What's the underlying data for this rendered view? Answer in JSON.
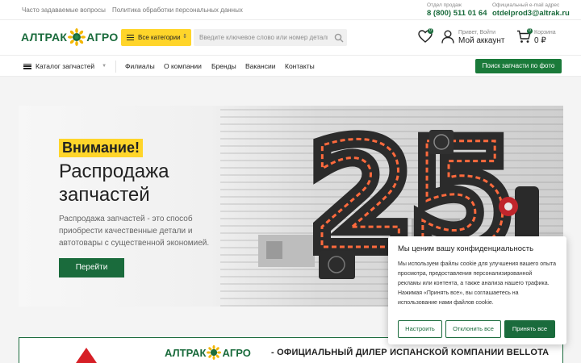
{
  "topbar": {
    "links": [
      "Часто задаваемые вопросы",
      "Политика обработки персональных данных"
    ],
    "sales_caption": "Отдел продаж",
    "sales_phone": "8 (800) 511 01 64",
    "email_caption": "Официальный e-mail адрес",
    "email": "otdelprod3@altrak.ru"
  },
  "header": {
    "logo_left": "АЛТРАК",
    "logo_right": "АГРО",
    "categories_label": "Все категории",
    "search_placeholder": "Введите ключевое слово или номер детали",
    "favorites_count": "0",
    "account_greeting": "Привет, Войти",
    "account_label": "Мой аккаунт",
    "cart_count": "0",
    "cart_caption": "Корзина",
    "cart_total": "0 ₽"
  },
  "nav": {
    "catalog_label": "Каталог запчастей",
    "items": [
      "Филиалы",
      "О компании",
      "Бренды",
      "Вакансии",
      "Контакты"
    ],
    "photo_search_label": "Поиск запчасти по фото"
  },
  "banner": {
    "note": "Внимание!",
    "title": "Распродажа запчастей",
    "description": "Распродажа запчастей - это способ приобрести качественные детали и автотовары с существенной экономией.",
    "button_label": "Перейти",
    "art_number": "25"
  },
  "dealer_strip": {
    "logo_left": "АЛТРАК",
    "logo_right": "АГРО",
    "text": "- ОФИЦИАЛЬНЫЙ ДИЛЕР ИСПАНСКОЙ КОМПАНИИ BELLOTA"
  },
  "cookie": {
    "title": "Мы ценим вашу конфиденциальность",
    "text": "Мы используем файлы cookie для улучшения вашего опыта просмотра, предоставления персонализированной рекламы или контента, а также анализа нашего трафика. Нажимая «Принять все», вы соглашаетесь на использование нами файлов cookie.",
    "customize_label": "Настроить",
    "reject_label": "Отклонить все",
    "accept_label": "Принять все"
  },
  "colors": {
    "brand_green": "#1a6b3c",
    "accent_yellow": "#ffd52a"
  }
}
